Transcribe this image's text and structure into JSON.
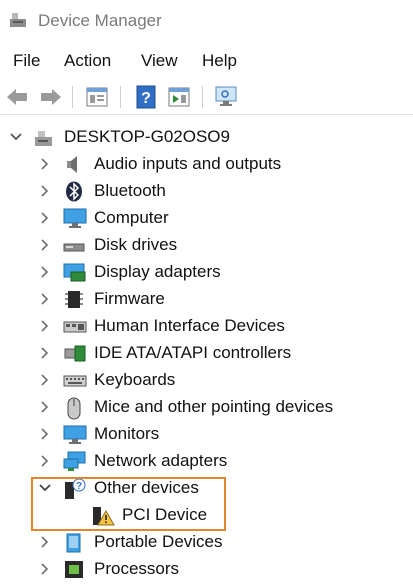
{
  "window": {
    "title": "Device Manager",
    "icon": "device-manager-icon"
  },
  "menu": [
    "File",
    "Action",
    "View",
    "Help"
  ],
  "toolbar": {
    "buttons": [
      "back-icon",
      "forward-icon",
      "properties-pane-icon",
      "help-icon",
      "action-pane-icon",
      "monitor-scan-icon"
    ]
  },
  "tree": {
    "root": {
      "label": "DESKTOP-G02OSO9",
      "icon": "computer-tree-icon",
      "expanded": true
    },
    "categories": [
      {
        "label": "Audio inputs and outputs",
        "icon": "speaker-icon",
        "expanded": false
      },
      {
        "label": "Bluetooth",
        "icon": "bluetooth-icon",
        "expanded": false
      },
      {
        "label": "Computer",
        "icon": "computer-icon",
        "expanded": false
      },
      {
        "label": "Disk drives",
        "icon": "disk-drive-icon",
        "expanded": false
      },
      {
        "label": "Display adapters",
        "icon": "display-adapter-icon",
        "expanded": false
      },
      {
        "label": "Firmware",
        "icon": "firmware-icon",
        "expanded": false
      },
      {
        "label": "Human Interface Devices",
        "icon": "hid-icon",
        "expanded": false
      },
      {
        "label": "IDE ATA/ATAPI controllers",
        "icon": "ide-controller-icon",
        "expanded": false
      },
      {
        "label": "Keyboards",
        "icon": "keyboard-icon",
        "expanded": false
      },
      {
        "label": "Mice and other pointing devices",
        "icon": "mouse-icon",
        "expanded": false
      },
      {
        "label": "Monitors",
        "icon": "monitor-icon",
        "expanded": false
      },
      {
        "label": "Network adapters",
        "icon": "network-adapter-icon",
        "expanded": false
      },
      {
        "label": "Other devices",
        "icon": "unknown-device-icon",
        "expanded": true,
        "children": [
          {
            "label": "PCI Device",
            "icon": "warning-device-icon",
            "status": "warning"
          }
        ]
      },
      {
        "label": "Portable Devices",
        "icon": "portable-device-icon",
        "expanded": false
      },
      {
        "label": "Processors",
        "icon": "processor-icon",
        "expanded": false
      }
    ]
  },
  "colors": {
    "highlight_border": "#e3862b",
    "title_text": "#7a7a7a",
    "chevron": "#6f6f6f"
  }
}
